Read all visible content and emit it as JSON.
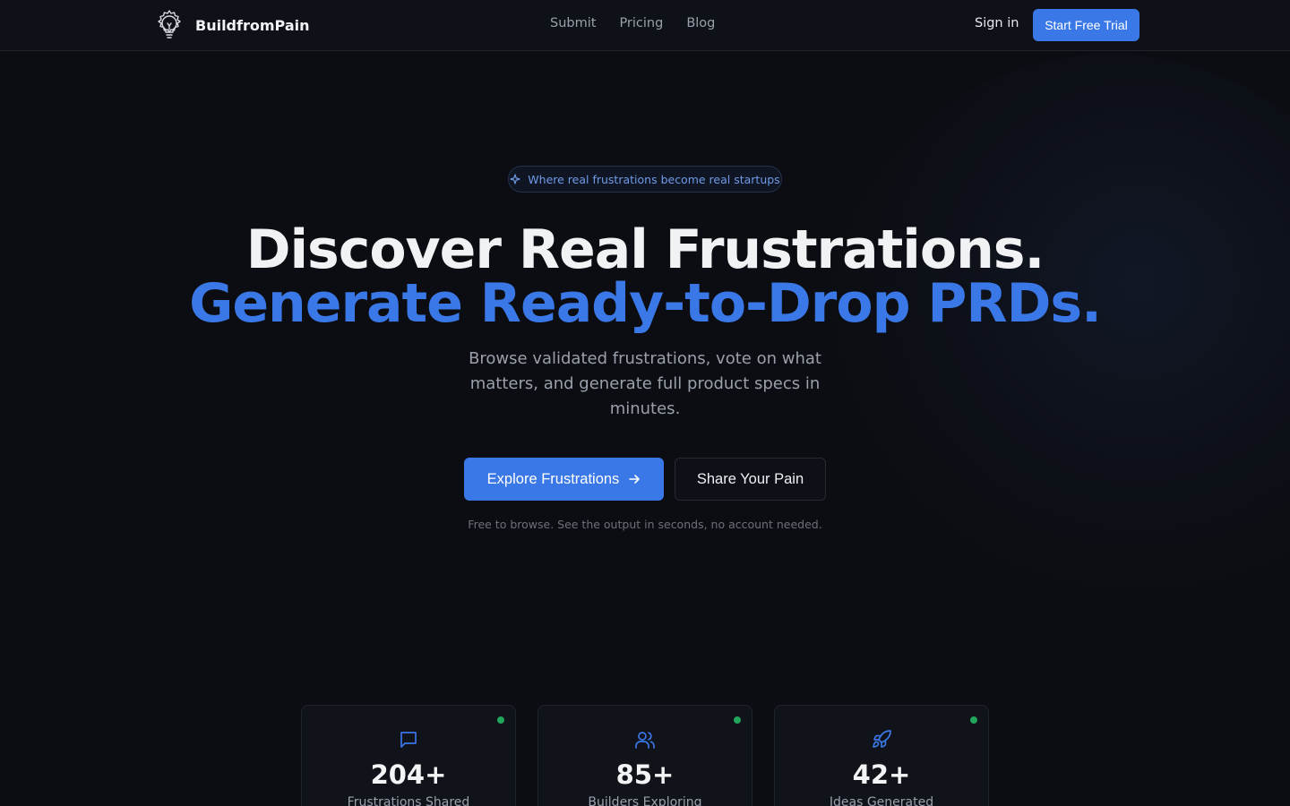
{
  "header": {
    "brand": "BuildfromPain",
    "nav": [
      {
        "label": "Submit"
      },
      {
        "label": "Pricing"
      },
      {
        "label": "Blog"
      }
    ],
    "sign_in": "Sign in",
    "trial": "Start Free Trial"
  },
  "hero": {
    "badge": "Where real frustrations become real startups",
    "title_line1": "Discover Real Frustrations.",
    "title_line2": "Generate Ready-to-Drop PRDs.",
    "subtitle": "Browse validated frustrations, vote on what matters, and generate full product specs in minutes.",
    "cta_primary": "Explore Frustrations",
    "cta_secondary": "Share Your Pain",
    "note": "Free to browse. See the output in seconds, no account needed."
  },
  "stats": [
    {
      "value": "204+",
      "label": "Frustrations Shared",
      "icon": "message-square-icon"
    },
    {
      "value": "85+",
      "label": "Builders Exploring",
      "icon": "users-icon"
    },
    {
      "value": "42+",
      "label": "Ideas Generated",
      "icon": "rocket-icon"
    }
  ],
  "colors": {
    "accent": "#3b78e7",
    "background": "#0b0d12",
    "status_dot": "#22a55a"
  }
}
